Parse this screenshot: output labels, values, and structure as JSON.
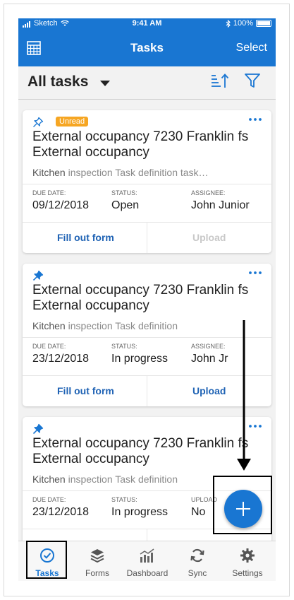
{
  "status_bar": {
    "carrier": "Sketch",
    "time": "9:41 AM",
    "battery": "100%"
  },
  "app_bar": {
    "title": "Tasks",
    "select_label": "Select",
    "left_icon": "calendar-grid-icon"
  },
  "list_header": {
    "title": "All tasks",
    "sort_icon": "sort-icon",
    "filter_icon": "filter-icon"
  },
  "labels": {
    "due_date": "DUE DATE:",
    "status": "STATUS:",
    "assignee": "ASSIGNEE:",
    "assignee_truncated": "UPLOAD",
    "fill_out_form": "Fill out form",
    "upload": "Upload"
  },
  "cards": [
    {
      "pinned": false,
      "badge": "Unread",
      "title": "External occupancy 7230 Franklin fs External occupancy",
      "desc_lead": "Kitchen",
      "desc_rest": " inspection Task definition task…",
      "due_date": "09/12/2018",
      "status": "Open",
      "assignee": "John Junior",
      "upload_enabled": false
    },
    {
      "pinned": true,
      "title": "External occupancy 7230 Franklin fs External occupancy",
      "desc_lead": "Kitchen",
      "desc_rest": " inspection Task definition",
      "due_date": "23/12/2018",
      "status": "In progress",
      "assignee": "John Jr",
      "upload_enabled": true
    },
    {
      "pinned": true,
      "title": "External occupancy 7230 Franklin fs External occupancy",
      "desc_lead": "Kitchen",
      "desc_rest": " inspection Task definition",
      "due_date": "23/12/2018",
      "status": "In progress",
      "assignee": "No",
      "upload_enabled": true
    }
  ],
  "fab": {
    "icon": "plus-icon"
  },
  "tabs": [
    {
      "label": "Tasks",
      "icon": "tasks-icon",
      "active": true
    },
    {
      "label": "Forms",
      "icon": "stack-icon",
      "active": false
    },
    {
      "label": "Dashboard",
      "icon": "bar-chart-icon",
      "active": false
    },
    {
      "label": "Sync",
      "icon": "sync-icon",
      "active": false
    },
    {
      "label": "Settings",
      "icon": "gear-icon",
      "active": false
    }
  ],
  "colors": {
    "brand_blue": "#1976d2",
    "link_blue": "#1e62b4",
    "badge_orange": "#f6a623",
    "disabled_gray": "#c8c8c8"
  }
}
